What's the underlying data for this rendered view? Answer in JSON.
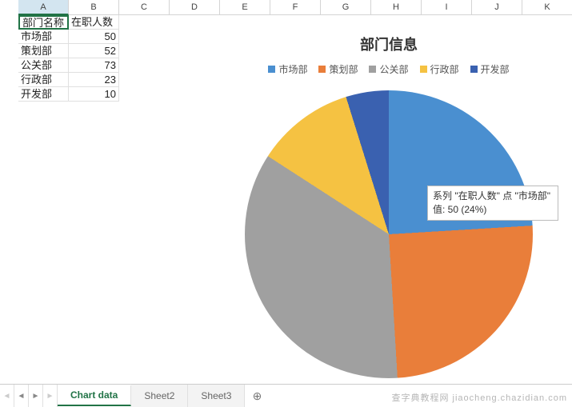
{
  "columns": [
    "A",
    "B",
    "C",
    "D",
    "E",
    "F",
    "G",
    "H",
    "I",
    "J",
    "K"
  ],
  "cells": {
    "header_dept": "部门名称",
    "header_count": "在职人数",
    "dept0": "市场部",
    "cnt0": "50",
    "dept1": "策划部",
    "cnt1": "52",
    "dept2": "公关部",
    "cnt2": "73",
    "dept3": "行政部",
    "cnt3": "23",
    "dept4": "开发部",
    "cnt4": "10"
  },
  "chart": {
    "title": "部门信息",
    "legend": {
      "l0": "市场部",
      "l1": "策划部",
      "l2": "公关部",
      "l3": "行政部",
      "l4": "开发部"
    },
    "colors": {
      "c0": "#4A8FD0",
      "c1": "#E97E3A",
      "c2": "#A0A0A0",
      "c3": "#F5C242",
      "c4": "#3A61B0"
    }
  },
  "tooltip": {
    "line1": "系列 \"在职人数\" 点 \"市场部\"",
    "line2": "值: 50 (24%)"
  },
  "tabs": {
    "t0": "Chart data",
    "t1": "Sheet2",
    "t2": "Sheet3",
    "new": "⊕"
  },
  "watermark": "查字典教程网 jiaocheng.chazidian.com",
  "chart_data": {
    "type": "pie",
    "title": "部门信息",
    "series_name": "在职人数",
    "categories": [
      "市场部",
      "策划部",
      "公关部",
      "行政部",
      "开发部"
    ],
    "values": [
      50,
      52,
      73,
      23,
      10
    ],
    "percentages": [
      24,
      25,
      35,
      11,
      5
    ],
    "colors": [
      "#4A8FD0",
      "#E97E3A",
      "#A0A0A0",
      "#F5C242",
      "#3A61B0"
    ]
  }
}
